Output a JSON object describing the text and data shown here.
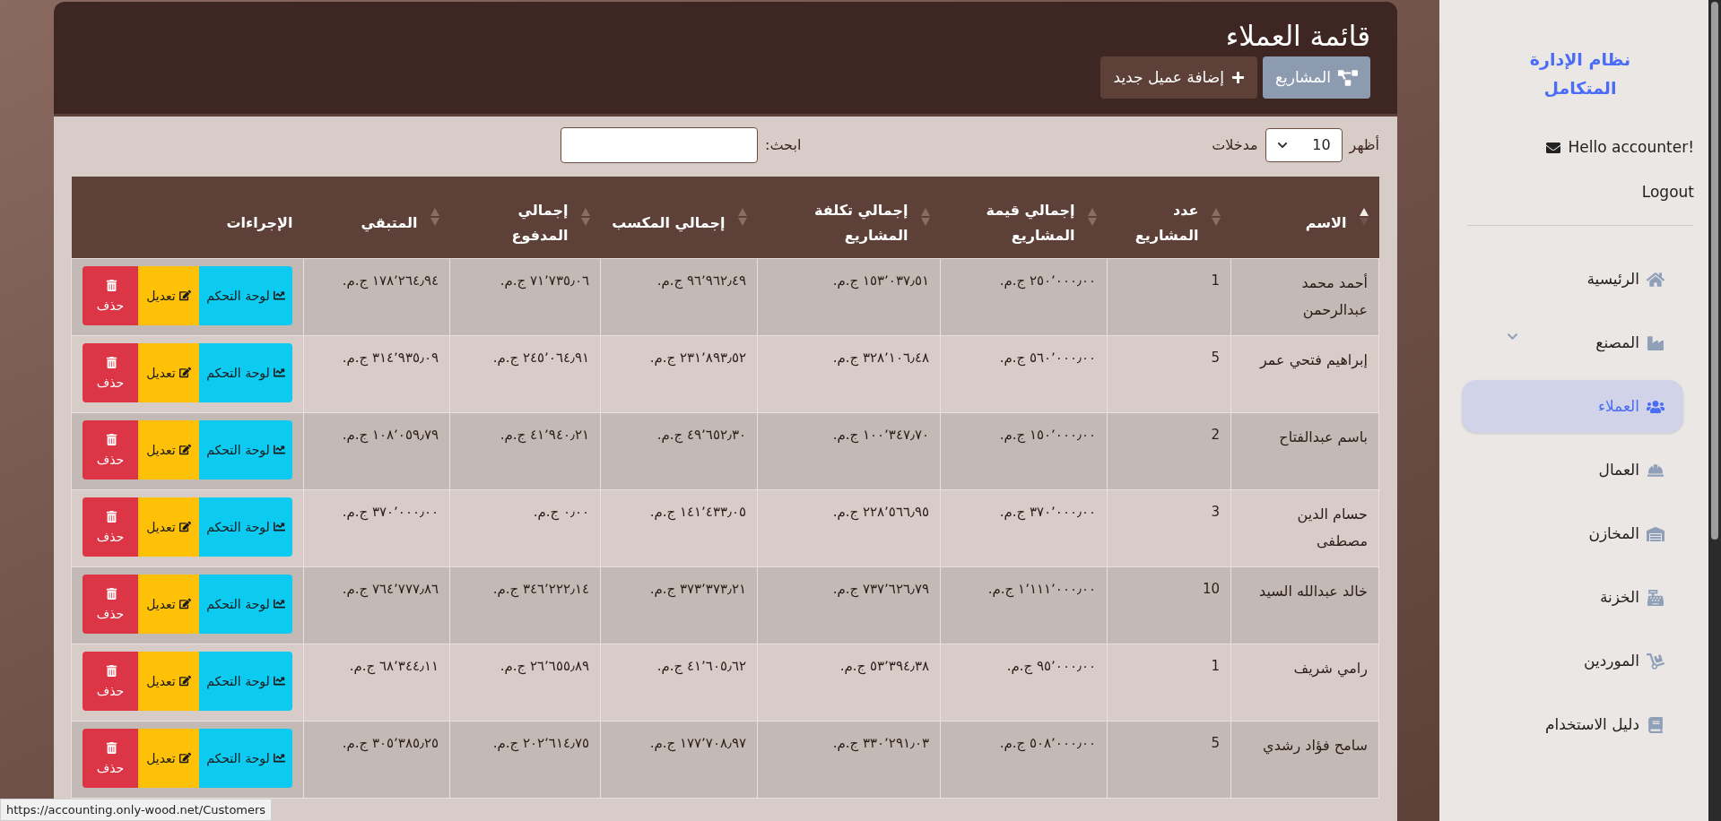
{
  "page": {
    "title": "قائمة العملاء",
    "buttons": [
      {
        "label": "المشاريع",
        "kind": "secondary"
      },
      {
        "label": "إضافة عميل جديد",
        "kind": "primary"
      }
    ]
  },
  "table_controls": {
    "show_label": "أظهر",
    "page_size": "10",
    "entries_label": "مدخلات",
    "search_label": "ابحث:"
  },
  "table": {
    "columns": [
      {
        "label": "الاسم",
        "sortable": true,
        "sorted": true
      },
      {
        "label": "عدد المشاريع",
        "sortable": true,
        "sorted": false
      },
      {
        "label": "إجمالي قيمة المشاريع",
        "sortable": true,
        "sorted": false
      },
      {
        "label": "إجمالي تكلفة المشاريع",
        "sortable": true,
        "sorted": false
      },
      {
        "label": "إجمالي المكسب",
        "sortable": true,
        "sorted": false
      },
      {
        "label": "إجمالي المدفوع",
        "sortable": true,
        "sorted": false
      },
      {
        "label": "المتبقي",
        "sortable": true,
        "sorted": false
      },
      {
        "label": "الإجراءات"
      }
    ],
    "rows": [
      {
        "cells": [
          "أحمد محمد عبدالرحمن",
          "1",
          "٢٥٠٬٠٠٠٫٠٠ ج.م.",
          "١٥٣٬٠٣٧٫٥١ ج.م.",
          "٩٦٬٩٦٢٫٤٩ ج.م.",
          "٧١٬٧٣٥٫٠٦ ج.م.",
          "١٧٨٬٢٦٤٫٩٤ ج.م."
        ],
        "actions": [
          {
            "label": "لوحة التحكم",
            "kind": "dashboard"
          },
          {
            "label": "تعديل",
            "kind": "edit"
          },
          {
            "label": "حذف",
            "kind": "delete"
          }
        ]
      },
      {
        "cells": [
          "إبراهيم فتحي عمر",
          "5",
          "٥٦٠٬٠٠٠٫٠٠ ج.م.",
          "٣٢٨٬١٠٦٫٤٨ ج.م.",
          "٢٣١٬٨٩٣٫٥٢ ج.م.",
          "٢٤٥٬٠٦٤٫٩١ ج.م.",
          "٣١٤٬٩٣٥٫٠٩ ج.م."
        ],
        "actions": [
          {
            "label": "لوحة التحكم",
            "kind": "dashboard"
          },
          {
            "label": "تعديل",
            "kind": "edit"
          },
          {
            "label": "حذف",
            "kind": "delete"
          }
        ]
      },
      {
        "cells": [
          "باسم عبدالفتاح",
          "2",
          "١٥٠٬٠٠٠٫٠٠ ج.م.",
          "١٠٠٬٣٤٧٫٧٠ ج.م.",
          "٤٩٬٦٥٢٫٣٠ ج.م.",
          "٤١٬٩٤٠٫٢١ ج.م.",
          "١٠٨٬٠٥٩٫٧٩ ج.م."
        ],
        "actions": [
          {
            "label": "لوحة التحكم",
            "kind": "dashboard"
          },
          {
            "label": "تعديل",
            "kind": "edit"
          },
          {
            "label": "حذف",
            "kind": "delete"
          }
        ]
      },
      {
        "cells": [
          "حسام الدين مصطفى",
          "3",
          "٣٧٠٬٠٠٠٫٠٠ ج.م.",
          "٢٢٨٬٥٦٦٫٩٥ ج.م.",
          "١٤١٬٤٣٣٫٠٥ ج.م.",
          "٠٫٠٠ ج.م.",
          "٣٧٠٬٠٠٠٫٠٠ ج.م."
        ],
        "actions": [
          {
            "label": "لوحة التحكم",
            "kind": "dashboard"
          },
          {
            "label": "تعديل",
            "kind": "edit"
          },
          {
            "label": "حذف",
            "kind": "delete"
          }
        ]
      },
      {
        "cells": [
          "خالد عبدالله السيد",
          "10",
          "١٬١١١٬٠٠٠٫٠٠ ج.م.",
          "٧٣٧٬٦٢٦٫٧٩ ج.م.",
          "٣٧٣٬٣٧٣٫٢١ ج.م.",
          "٣٤٦٬٢٢٢٫١٤ ج.م.",
          "٧٦٤٬٧٧٧٫٨٦ ج.م."
        ],
        "actions": [
          {
            "label": "لوحة التحكم",
            "kind": "dashboard"
          },
          {
            "label": "تعديل",
            "kind": "edit"
          },
          {
            "label": "حذف",
            "kind": "delete"
          }
        ]
      },
      {
        "cells": [
          "رامي شريف",
          "1",
          "٩٥٬٠٠٠٫٠٠ ج.م.",
          "٥٣٬٣٩٤٫٣٨ ج.م.",
          "٤١٬٦٠٥٫٦٢ ج.م.",
          "٢٦٬٦٥٥٫٨٩ ج.م.",
          "٦٨٬٣٤٤٫١١ ج.م."
        ],
        "actions": [
          {
            "label": "لوحة التحكم",
            "kind": "dashboard"
          },
          {
            "label": "تعديل",
            "kind": "edit"
          },
          {
            "label": "حذف",
            "kind": "delete"
          }
        ]
      },
      {
        "cells": [
          "سامح فؤاد رشدي",
          "5",
          "٥٠٨٬٠٠٠٫٠٠ ج.م.",
          "٣٣٠٬٢٩١٫٠٣ ج.م.",
          "١٧٧٬٧٠٨٫٩٧ ج.م.",
          "٢٠٢٬٦١٤٫٧٥ ج.م.",
          "٣٠٥٬٣٨٥٫٢٥ ج.م."
        ],
        "actions": [
          {
            "label": "لوحة التحكم",
            "kind": "dashboard"
          },
          {
            "label": "تعديل",
            "kind": "edit"
          },
          {
            "label": "حذف",
            "kind": "delete"
          }
        ]
      }
    ]
  },
  "sidebar": {
    "brand": "نظام الإدارة المتكامل",
    "greeting": "Hello accounter!",
    "logout": "Logout",
    "items": [
      {
        "label": "الرئيسية",
        "kind": "link",
        "selected": false
      },
      {
        "label": "المصنع",
        "kind": "group",
        "expanded": false,
        "selected": false
      },
      {
        "label": "العملاء",
        "kind": "link",
        "selected": true
      },
      {
        "label": "العمال",
        "kind": "link",
        "selected": false
      },
      {
        "label": "المخازن",
        "kind": "link",
        "selected": false
      },
      {
        "label": "الخزنة",
        "kind": "link",
        "selected": false
      },
      {
        "label": "الموردين",
        "kind": "link",
        "selected": false
      },
      {
        "label": "دليل الاستخدام",
        "kind": "link",
        "selected": false
      }
    ]
  },
  "status_bar": {
    "url": "https://accounting.only-wood.net/Customers"
  }
}
